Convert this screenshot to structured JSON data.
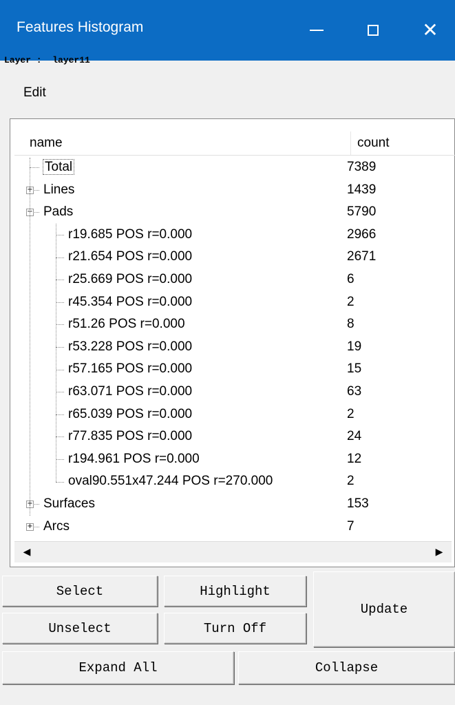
{
  "window": {
    "title": "Features Histogram"
  },
  "layer_line": "Layer :  layer11",
  "menu": {
    "edit": "Edit"
  },
  "table": {
    "headers": {
      "name": "name",
      "count": "count"
    },
    "rows": [
      {
        "name": "Total",
        "count": "7389",
        "level": 0,
        "expander": "none"
      },
      {
        "name": "Lines",
        "count": "1439",
        "level": 0,
        "expander": "plus"
      },
      {
        "name": "Pads",
        "count": "5790",
        "level": 0,
        "expander": "minus"
      },
      {
        "name": "r19.685  POS r=0.000",
        "count": "2966",
        "level": 1
      },
      {
        "name": "r21.654  POS r=0.000",
        "count": "2671",
        "level": 1
      },
      {
        "name": "r25.669  POS r=0.000",
        "count": "6",
        "level": 1
      },
      {
        "name": "r45.354  POS r=0.000",
        "count": "2",
        "level": 1
      },
      {
        "name": "r51.26  POS r=0.000",
        "count": "8",
        "level": 1
      },
      {
        "name": "r53.228  POS r=0.000",
        "count": "19",
        "level": 1
      },
      {
        "name": "r57.165  POS r=0.000",
        "count": "15",
        "level": 1
      },
      {
        "name": "r63.071  POS r=0.000",
        "count": "63",
        "level": 1
      },
      {
        "name": "r65.039  POS r=0.000",
        "count": "2",
        "level": 1
      },
      {
        "name": "r77.835  POS r=0.000",
        "count": "24",
        "level": 1
      },
      {
        "name": "r194.961  POS r=0.000",
        "count": "12",
        "level": 1
      },
      {
        "name": "oval90.551x47.244  POS r=270.000",
        "count": "2",
        "level": 1
      },
      {
        "name": "Surfaces",
        "count": "153",
        "level": 0,
        "expander": "plus"
      },
      {
        "name": "Arcs",
        "count": "7",
        "level": 0,
        "expander": "plus"
      }
    ]
  },
  "buttons": {
    "select": "Select",
    "highlight": "Highlight",
    "update": "Update",
    "unselect": "Unselect",
    "turn_off": "Turn Off",
    "expand_all": "Expand All",
    "collapse": "Collapse"
  }
}
